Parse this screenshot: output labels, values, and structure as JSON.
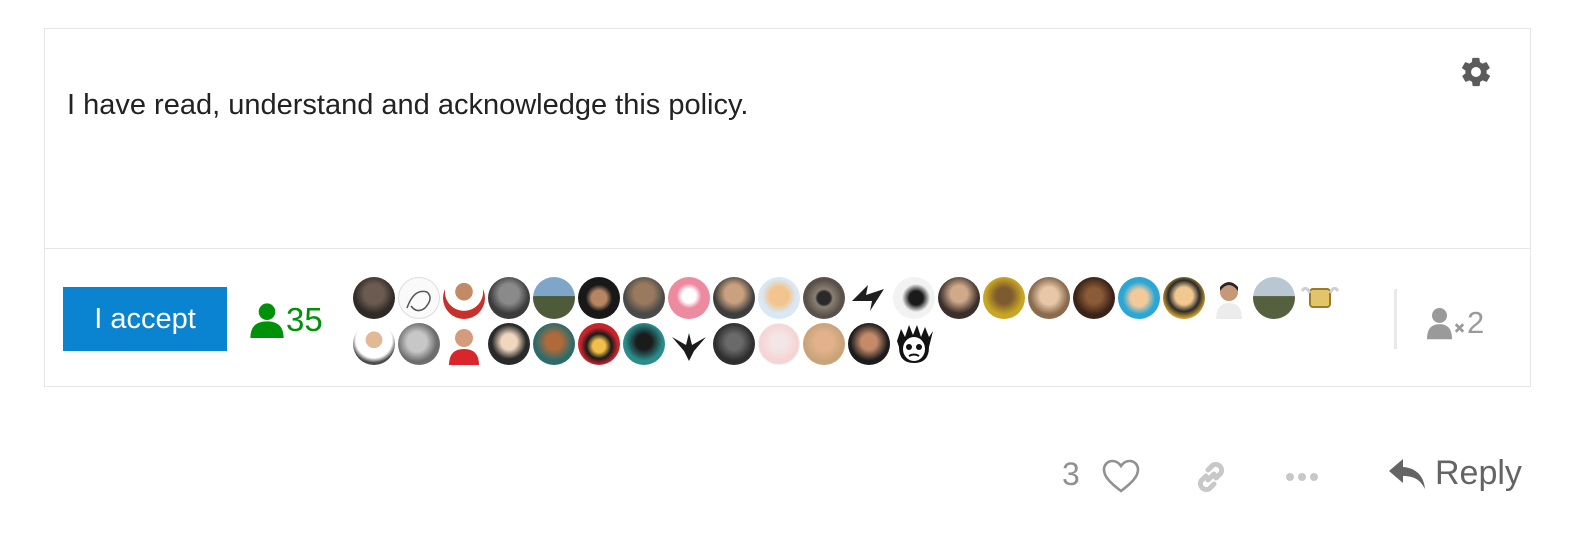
{
  "policy": {
    "text": "I have read, understand and acknowledge this policy.",
    "accept_label": "I accept",
    "accepted_count": "35",
    "not_accepted_count": "×2",
    "not_accepted_count_value": "2"
  },
  "post_actions": {
    "like_count": "3",
    "reply_label": "Reply"
  },
  "colors": {
    "accept_button": "#0a84d0",
    "accepted_green": "#00910a",
    "muted_gray": "#919191"
  },
  "icons": {
    "settings": "gear-icon",
    "accepted": "user-icon",
    "not_accepted": "user-times-icon",
    "like": "heart-icon",
    "share": "link-icon",
    "more": "ellipsis-icon",
    "reply": "reply-icon"
  }
}
